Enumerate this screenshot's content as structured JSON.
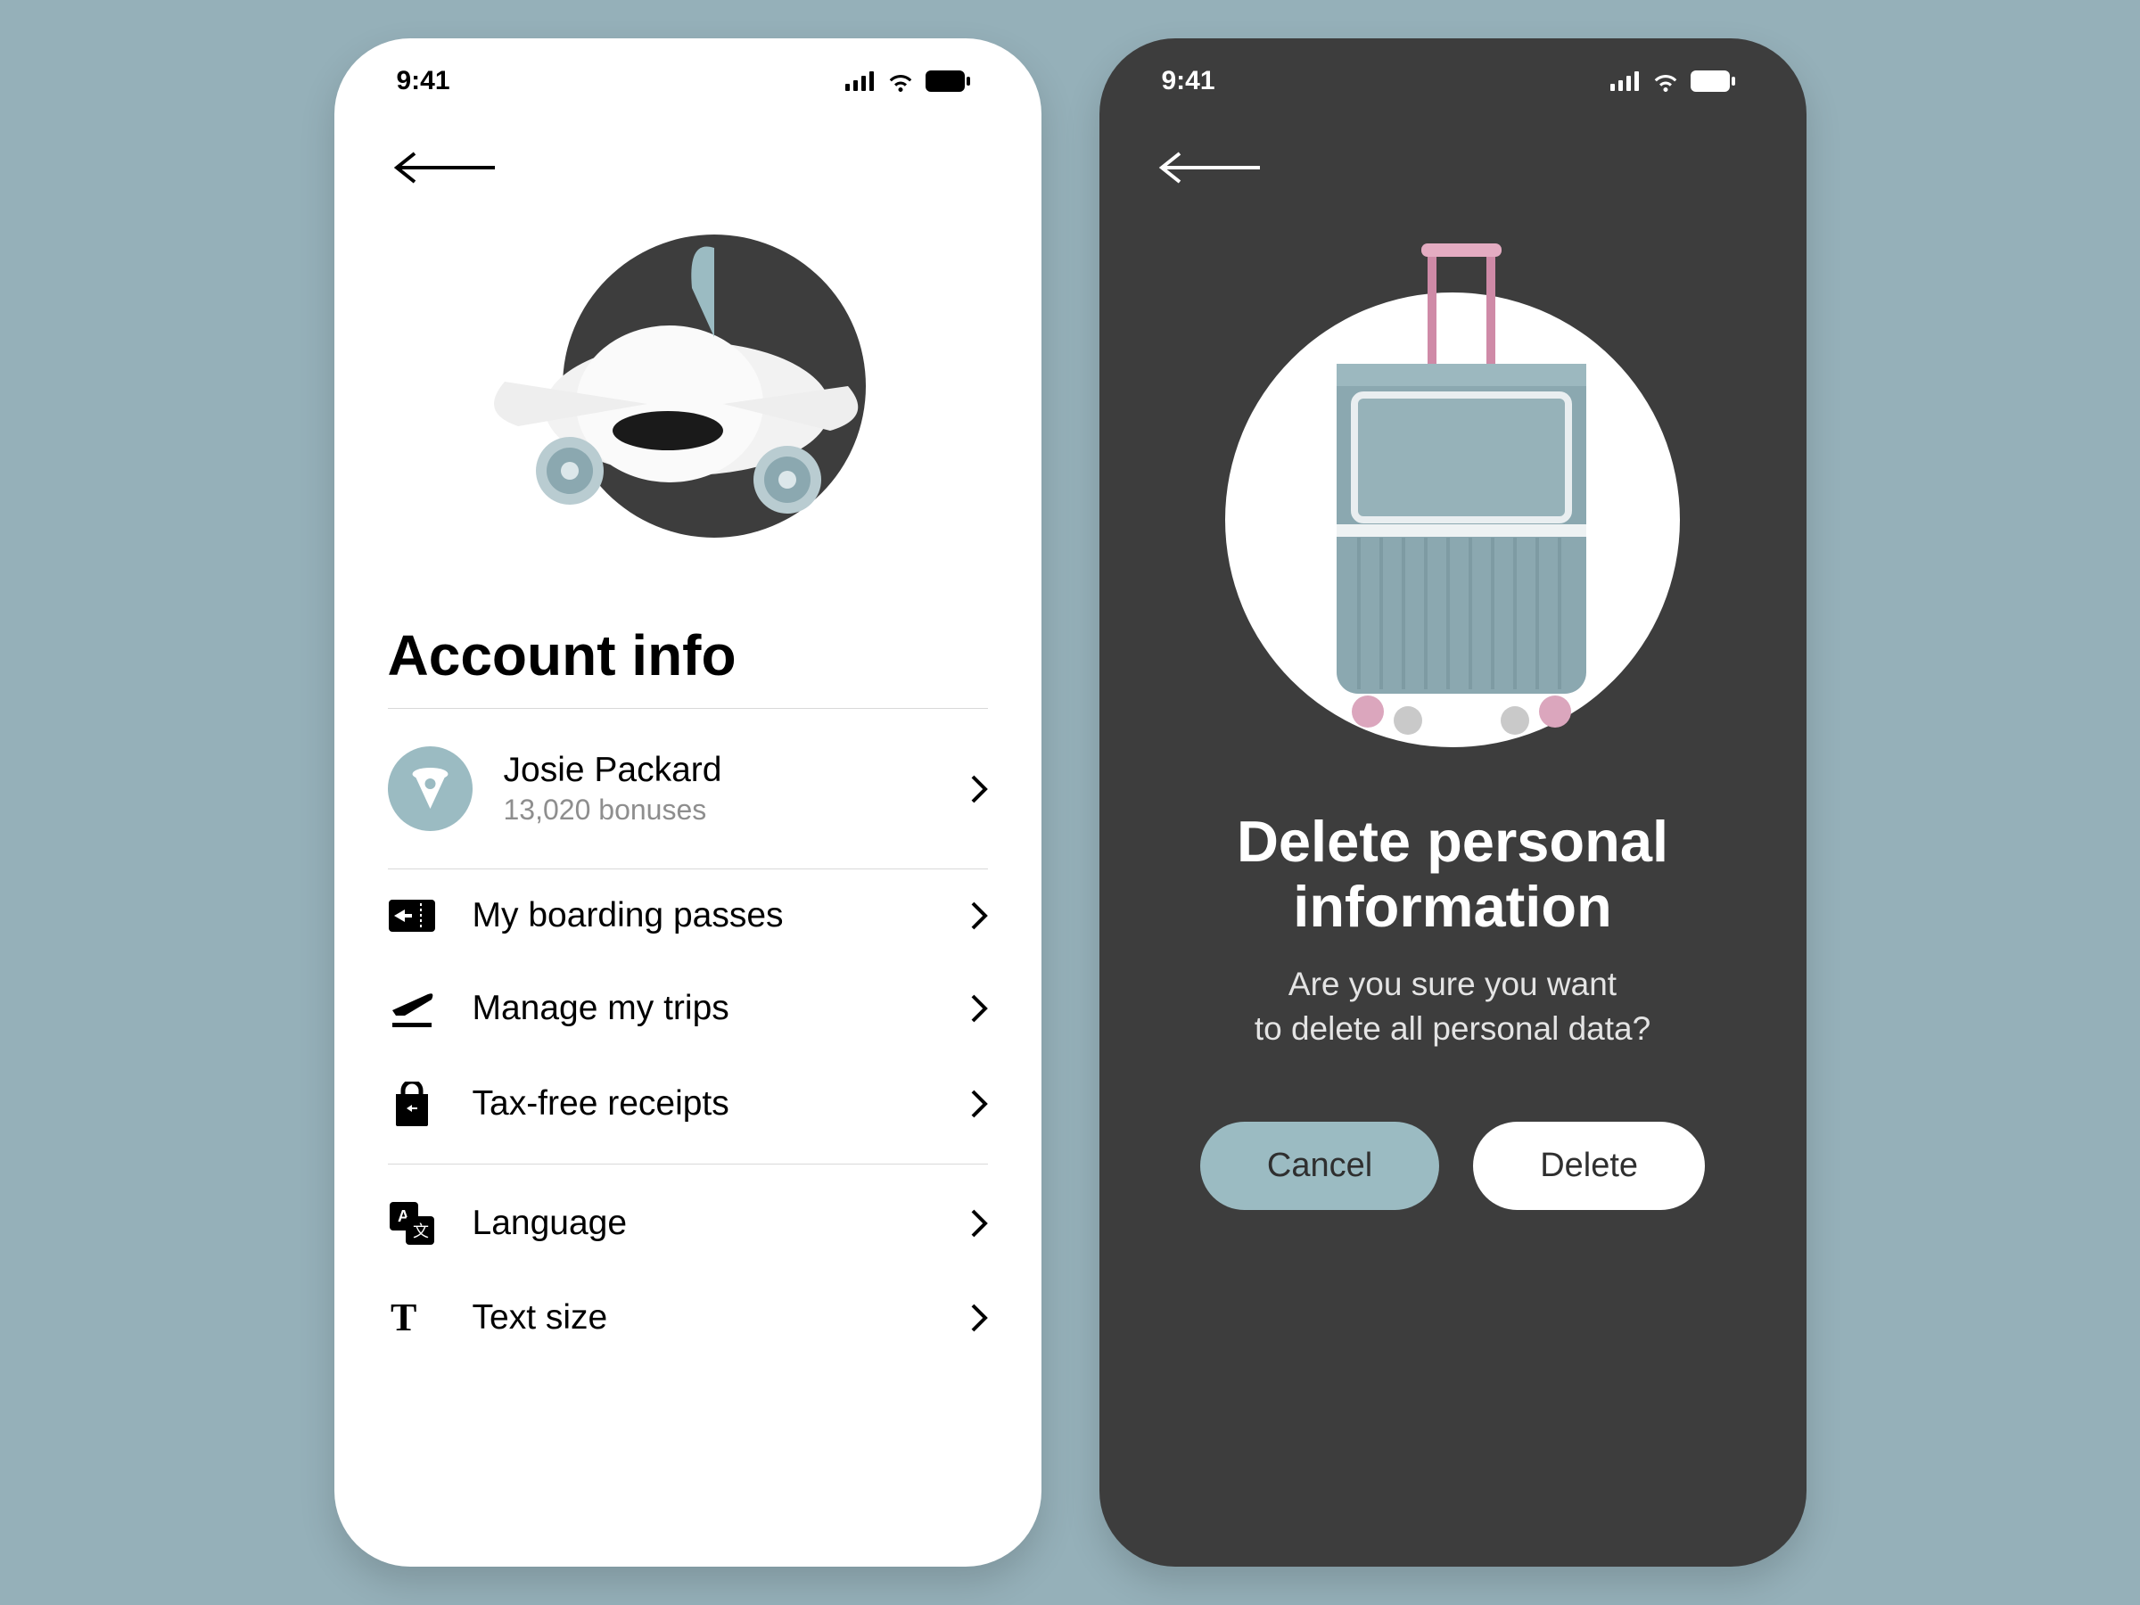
{
  "status": {
    "time": "9:41"
  },
  "screen1": {
    "heading": "Account info",
    "profile": {
      "name": "Josie Packard",
      "sub": "13,020 bonuses"
    },
    "group1": [
      {
        "label": "My boarding passes"
      },
      {
        "label": "Manage my trips"
      },
      {
        "label": "Tax-free receipts"
      }
    ],
    "group2": [
      {
        "label": "Language"
      },
      {
        "label": "Text size"
      }
    ]
  },
  "screen2": {
    "title_l1": "Delete personal",
    "title_l2": "information",
    "sub_l1": "Are you sure you want",
    "sub_l2": "to delete all personal data?",
    "cancel": "Cancel",
    "delete": "Delete"
  }
}
